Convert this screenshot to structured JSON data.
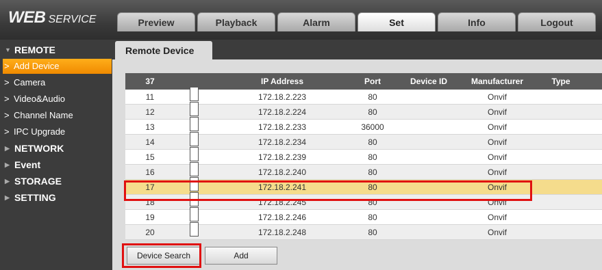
{
  "app": {
    "logo_main": "WEB",
    "logo_sub": "SERVICE"
  },
  "nav_tabs": [
    "Preview",
    "Playback",
    "Alarm",
    "Set",
    "Info",
    "Logout"
  ],
  "sidebar": {
    "sections": [
      "REMOTE",
      "NETWORK",
      "Event",
      "STORAGE",
      "SETTING"
    ],
    "remote_items": [
      "Add Device",
      "Camera",
      "Video&Audio",
      "Channel Name",
      "IPC Upgrade"
    ],
    "active_item": "Add Device"
  },
  "page_tab": "Remote Device",
  "table": {
    "headers": [
      "37",
      "",
      "IP Address",
      "Port",
      "Device ID",
      "Manufacturer",
      "Type"
    ],
    "rows": [
      {
        "num": "11",
        "ip": "172.18.2.223",
        "port": "80",
        "manufacturer": "Onvif"
      },
      {
        "num": "12",
        "ip": "172.18.2.224",
        "port": "80",
        "manufacturer": "Onvif"
      },
      {
        "num": "13",
        "ip": "172.18.2.233",
        "port": "36000",
        "manufacturer": "Onvif"
      },
      {
        "num": "14",
        "ip": "172.18.2.234",
        "port": "80",
        "manufacturer": "Onvif"
      },
      {
        "num": "15",
        "ip": "172.18.2.239",
        "port": "80",
        "manufacturer": "Onvif"
      },
      {
        "num": "16",
        "ip": "172.18.2.240",
        "port": "80",
        "manufacturer": "Onvif"
      },
      {
        "num": "17",
        "ip": "172.18.2.241",
        "port": "80",
        "manufacturer": "Onvif"
      },
      {
        "num": "18",
        "ip": "172.18.2.245",
        "port": "80",
        "manufacturer": "Onvif"
      },
      {
        "num": "19",
        "ip": "172.18.2.246",
        "port": "80",
        "manufacturer": "Onvif"
      },
      {
        "num": "20",
        "ip": "172.18.2.248",
        "port": "80",
        "manufacturer": "Onvif"
      }
    ],
    "selected_row": "17"
  },
  "buttons": {
    "device_search": "Device Search",
    "add": "Add"
  },
  "colors": {
    "active_item": "#f08a00",
    "selected_row": "#f5dc8c",
    "highlight": "#e01010",
    "table_header": "#5a5a5a"
  }
}
